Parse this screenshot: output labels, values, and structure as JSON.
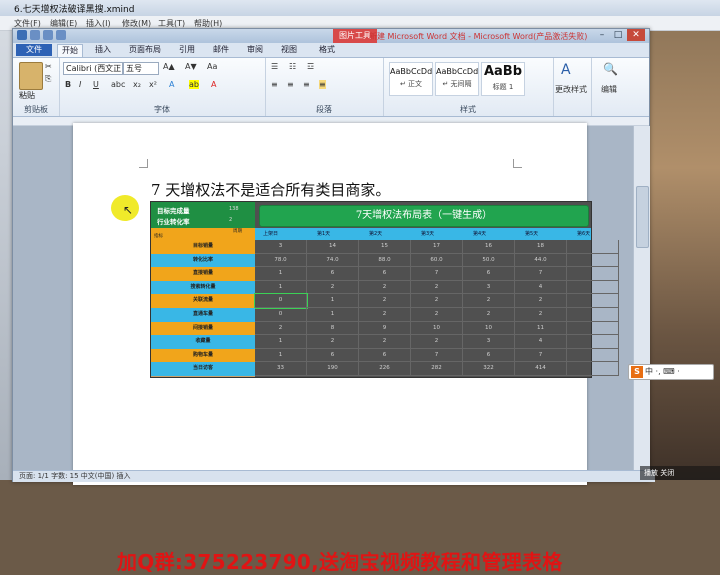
{
  "xmind": {
    "title": "6.七天增权法破译黑搜.xmind",
    "menu": [
      "文件(F)",
      "编辑(E)",
      "插入(I)",
      "修改(M)",
      "工具(T)",
      "帮助(H)"
    ]
  },
  "word": {
    "context_tab": "图片工具",
    "title": "新建 Microsoft Word 文档 - Microsoft Word(产品激活失败)",
    "tabs": [
      "文件",
      "开始",
      "插入",
      "页面布局",
      "引用",
      "邮件",
      "审阅",
      "视图",
      "格式"
    ],
    "clipboard": {
      "paste": "粘贴",
      "label": "剪贴板"
    },
    "font": {
      "name": "Calibri (西文正",
      "size": "五号",
      "label": "字体"
    },
    "paragraph_label": "段落",
    "styles": [
      {
        "preview": "AaBbCcDd",
        "name": "↵ 正文"
      },
      {
        "preview": "AaBbCcDd",
        "name": "↵ 无间隔"
      },
      {
        "preview": "AaBb",
        "name": "标题 1"
      }
    ],
    "styles_label": "样式",
    "change_styles": "更改样式",
    "editing": "编辑",
    "status": "页面: 1/1  字数: 15  中文(中国)  插入"
  },
  "document": {
    "heading": "7 天增权法不是适合所有类目商家。",
    "promo": "加Q群:375223790,送淘宝视频教程和管理表格"
  },
  "sheet": {
    "kpi": [
      {
        "label": "目标完成量",
        "value": "138"
      },
      {
        "label": "行业转化率",
        "value": "2"
      }
    ],
    "banner": "7天增权法布局表（一键生成）",
    "corner_top": "周期",
    "corner_bottom": "指标",
    "days": [
      "上架日",
      "第1天",
      "第2天",
      "第3天",
      "第4天",
      "第5天",
      "第6天"
    ],
    "rows": [
      {
        "label": "目标销量",
        "values": [
          "3",
          "14",
          "15",
          "17",
          "16",
          "18",
          ""
        ]
      },
      {
        "label": "转化比率",
        "values": [
          "78.0",
          "74.0",
          "88.0",
          "60.0",
          "50.0",
          "44.0",
          ""
        ]
      },
      {
        "label": "直接销量",
        "values": [
          "1",
          "6",
          "6",
          "7",
          "6",
          "7",
          ""
        ]
      },
      {
        "label": "搜索转化量",
        "values": [
          "1",
          "2",
          "2",
          "2",
          "3",
          "4",
          ""
        ]
      },
      {
        "label": "关联流量",
        "values": [
          "0",
          "1",
          "2",
          "2",
          "2",
          "2",
          ""
        ]
      },
      {
        "label": "直通车量",
        "values": [
          "0",
          "1",
          "2",
          "2",
          "2",
          "2",
          ""
        ]
      },
      {
        "label": "间接销量",
        "values": [
          "2",
          "8",
          "9",
          "10",
          "10",
          "11",
          ""
        ]
      },
      {
        "label": "收藏量",
        "values": [
          "1",
          "2",
          "2",
          "2",
          "3",
          "4",
          ""
        ]
      },
      {
        "label": "购物车量",
        "values": [
          "1",
          "6",
          "6",
          "7",
          "6",
          "7",
          ""
        ]
      },
      {
        "label": "当日访客",
        "values": [
          "33",
          "190",
          "226",
          "282",
          "322",
          "414",
          ""
        ]
      }
    ]
  },
  "taskbar": {
    "ime": "中 ·, ⌨ ·",
    "tray": "播放  关闭"
  }
}
